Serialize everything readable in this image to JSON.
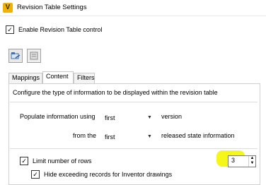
{
  "window": {
    "title": "Revision Table Settings"
  },
  "enable": {
    "label": "Enable Revision Table control",
    "checked": true
  },
  "tabs": [
    {
      "label": "Mappings"
    },
    {
      "label": "Content"
    },
    {
      "label": "Filters"
    }
  ],
  "content": {
    "description": "Configure the type of information to be displayed within the revision table",
    "populate": {
      "label": "Populate information using",
      "value": "first",
      "suffix": "version"
    },
    "from": {
      "label": "from the",
      "value": "first",
      "suffix": "released state information"
    },
    "limit": {
      "label": "Limit number of rows",
      "checked": true,
      "value": "3"
    },
    "hide": {
      "label": "Hide exceeding records for Inventor drawings",
      "checked": true
    }
  },
  "icons": {
    "app": "vault-app-icon",
    "toolbar": [
      "import-settings-icon",
      "export-settings-icon"
    ]
  },
  "colors": {
    "highlight": "#f4f500",
    "app_icon": "#f0b400"
  }
}
